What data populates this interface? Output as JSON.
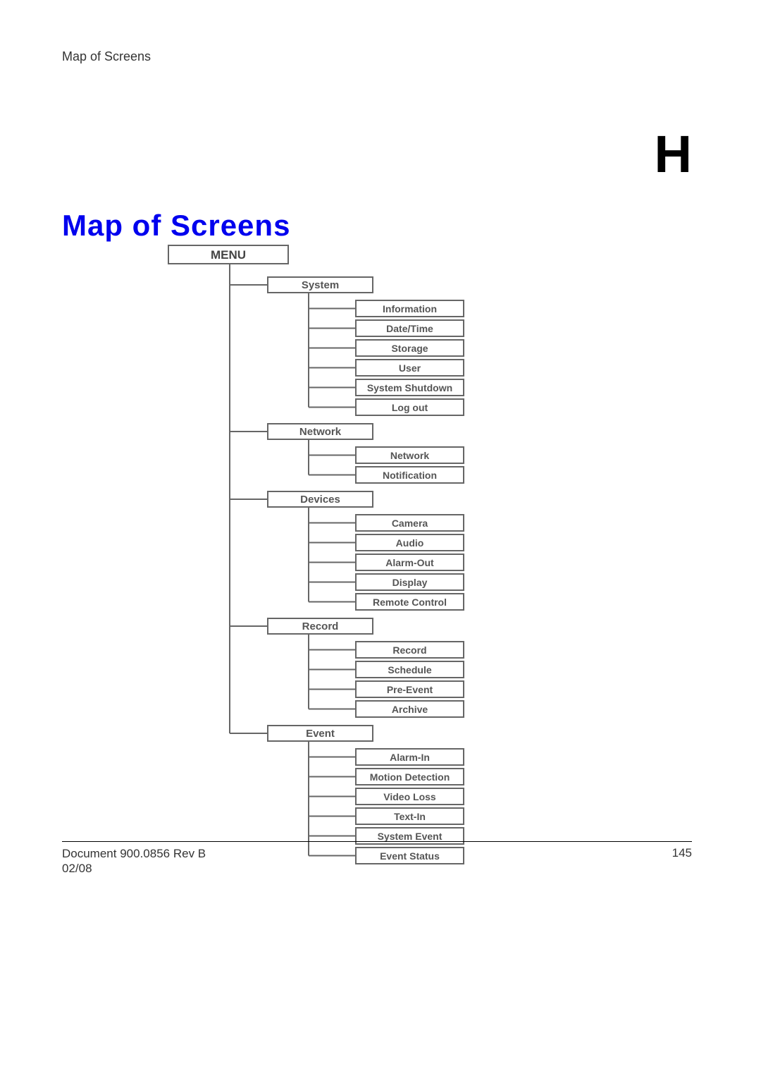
{
  "header": "Map of Screens",
  "appendix": "H",
  "title": "Map of Screens",
  "diagram": {
    "root": "MENU",
    "categories": [
      {
        "label": "System",
        "items": [
          "Information",
          "Date/Time",
          "Storage",
          "User",
          "System Shutdown",
          "Log out"
        ]
      },
      {
        "label": "Network",
        "items": [
          "Network",
          "Notification"
        ]
      },
      {
        "label": "Devices",
        "items": [
          "Camera",
          "Audio",
          "Alarm-Out",
          "Display",
          "Remote Control"
        ]
      },
      {
        "label": "Record",
        "items": [
          "Record",
          "Schedule",
          "Pre-Event",
          "Archive"
        ]
      },
      {
        "label": "Event",
        "items": [
          "Alarm-In",
          "Motion Detection",
          "Video Loss",
          "Text-In",
          "System Event",
          "Event Status"
        ]
      }
    ]
  },
  "footer": {
    "doc": "Document 900.0856 Rev B",
    "date": "02/08",
    "page": "145"
  }
}
